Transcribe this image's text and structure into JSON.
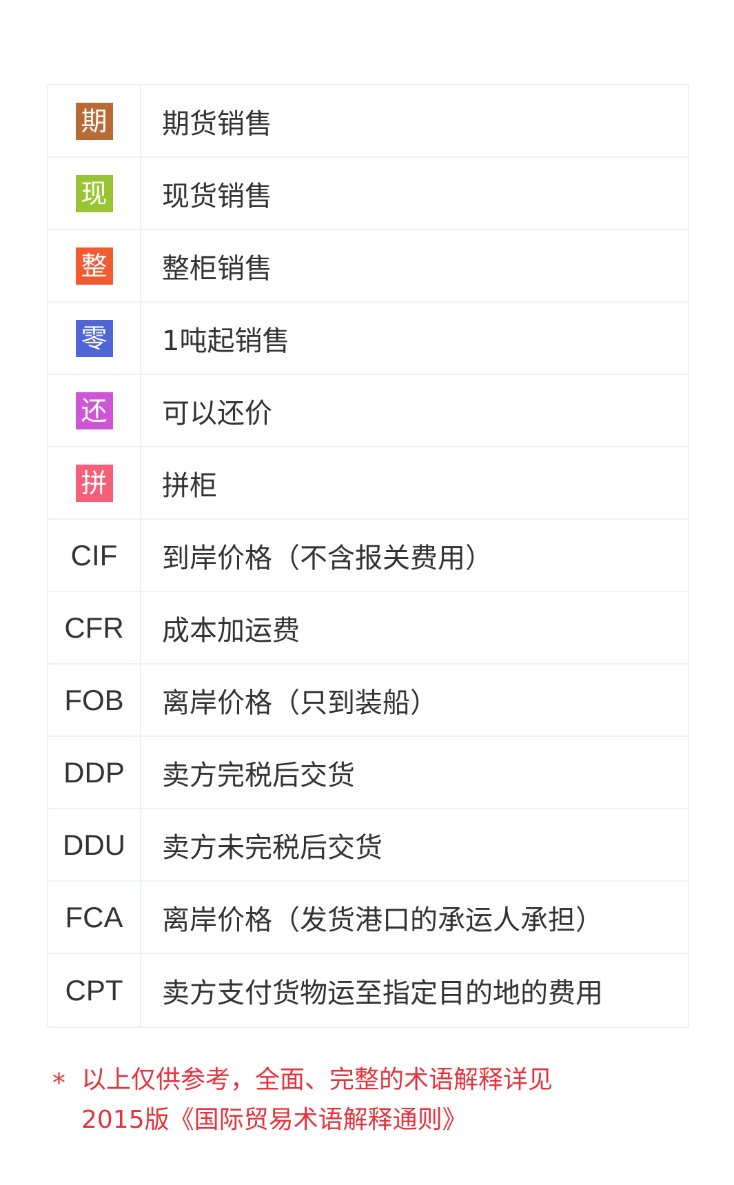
{
  "legend": {
    "rows": [
      {
        "type": "badge",
        "code": "期",
        "color": "#b86b34",
        "desc": "期货销售"
      },
      {
        "type": "badge",
        "code": "现",
        "color": "#9ac436",
        "desc": "现货销售"
      },
      {
        "type": "badge",
        "code": "整",
        "color": "#f25a32",
        "desc": "整柜销售"
      },
      {
        "type": "badge",
        "code": "零",
        "color": "#5166d6",
        "desc": "1吨起销售"
      },
      {
        "type": "badge",
        "code": "还",
        "color": "#cf55d7",
        "desc": "可以还价"
      },
      {
        "type": "badge",
        "code": "拼",
        "color": "#f55f7a",
        "desc": "拼柜"
      },
      {
        "type": "text",
        "code": "CIF",
        "desc": "到岸价格（不含报关费用）"
      },
      {
        "type": "text",
        "code": "CFR",
        "desc": "成本加运费"
      },
      {
        "type": "text",
        "code": "FOB",
        "desc": "离岸价格（只到装船）"
      },
      {
        "type": "text",
        "code": "DDP",
        "desc": "卖方完税后交货"
      },
      {
        "type": "text",
        "code": "DDU",
        "desc": "卖方未完税后交货"
      },
      {
        "type": "text",
        "code": "FCA",
        "desc": "离岸价格（发货港口的承运人承担）"
      },
      {
        "type": "text",
        "code": "CPT",
        "desc": "卖方支付货物运至指定目的地的费用"
      }
    ]
  },
  "footnote": {
    "star": "*",
    "line1": "以上仅供参考，全面、完整的术语解释详见",
    "line2": "2015版《国际贸易术语解释通则》"
  },
  "colors": {
    "footnote": "#e8323c",
    "border": "#edf1f7"
  }
}
